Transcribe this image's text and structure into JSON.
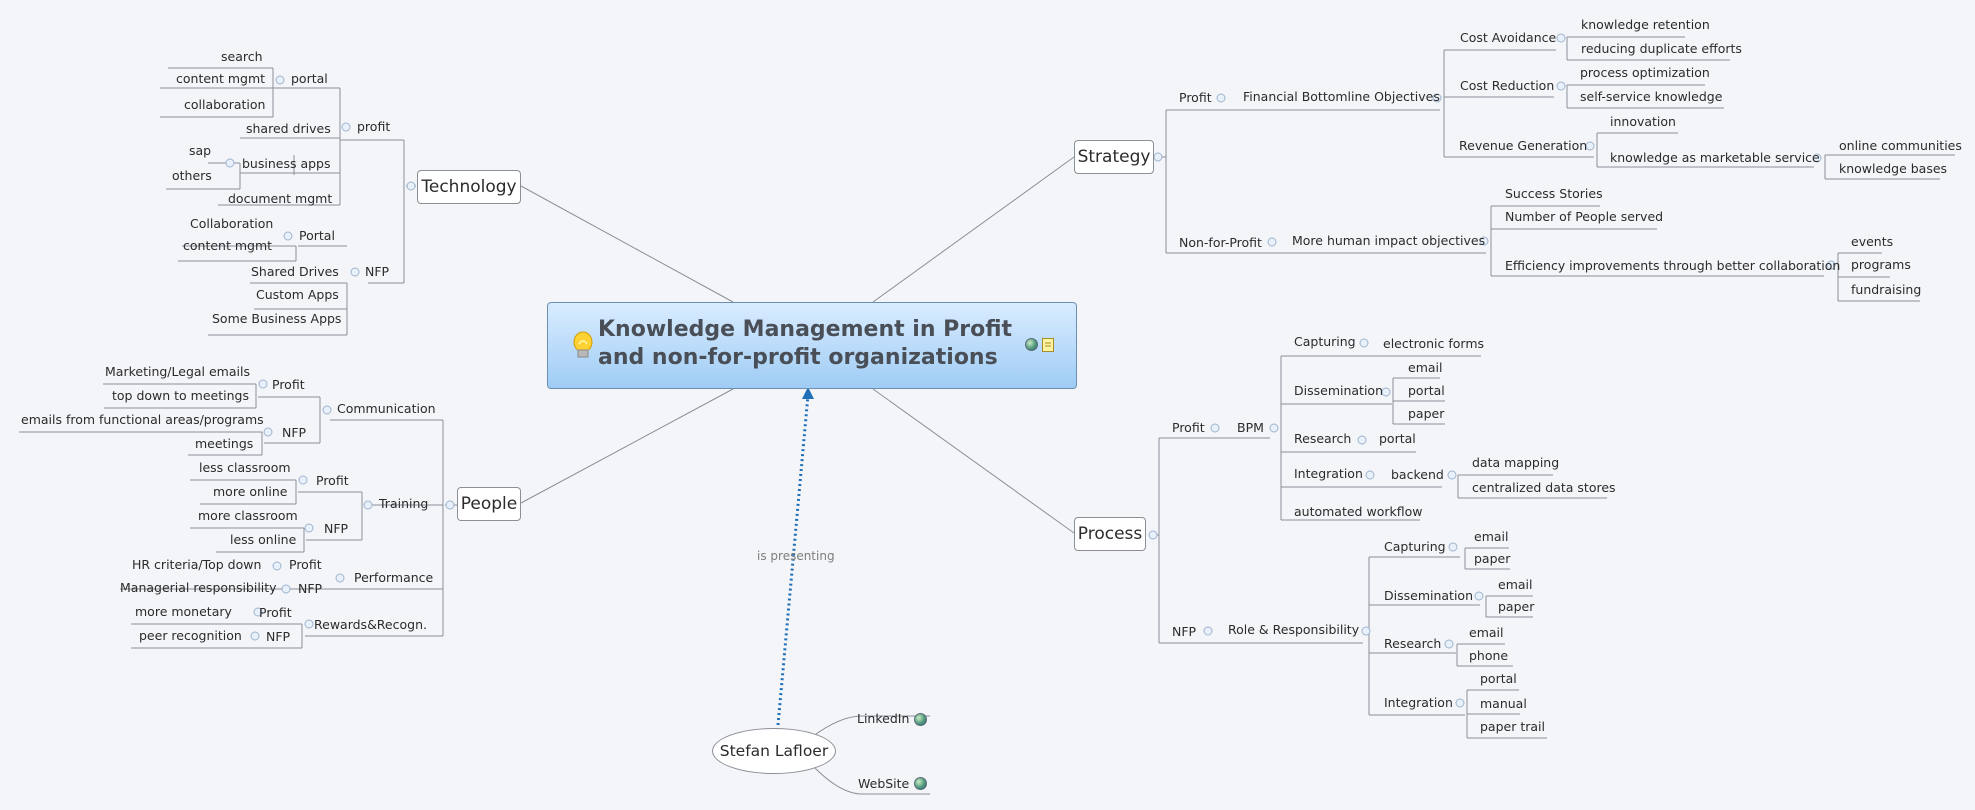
{
  "central": {
    "title_line1": "Knowledge Management in Profit",
    "title_line2": "and non-for-profit organizations",
    "icons": [
      "lightbulb-icon",
      "globe-icon",
      "note-icon"
    ]
  },
  "presenter": {
    "name": "Stefan Lafloer",
    "relationship_label": "is presenting",
    "links": [
      "LinkedIn",
      "WebSite"
    ]
  },
  "technology": {
    "label": "Technology",
    "profit": {
      "label": "profit",
      "portal": {
        "label": "portal",
        "items": [
          "search",
          "content mgmt",
          "collaboration"
        ]
      },
      "shared_drives": "shared drives",
      "business_apps": {
        "label": "business apps",
        "items": [
          "sap",
          "others"
        ]
      },
      "document_mgmt": "document mgmt"
    },
    "nfp": {
      "label": "NFP",
      "portal": {
        "label": "Portal",
        "items": [
          "Collaboration",
          "content mgmt"
        ]
      },
      "items": [
        "Shared Drives",
        "Custom Apps",
        "Some Business Apps"
      ]
    }
  },
  "people": {
    "label": "People",
    "communication": {
      "label": "Communication",
      "profit": {
        "label": "Profit",
        "items": [
          "Marketing/Legal emails",
          "top down to meetings"
        ]
      },
      "nfp": {
        "label": "NFP",
        "items": [
          "emails from functional areas/programs",
          "meetings"
        ]
      }
    },
    "training": {
      "label": "Training",
      "profit": {
        "label": "Profit",
        "items": [
          "less classroom",
          "more online"
        ]
      },
      "nfp": {
        "label": "NFP",
        "items": [
          "more classroom",
          "less online"
        ]
      }
    },
    "performance": {
      "label": "Performance",
      "profit": {
        "label": "Profit",
        "item": "HR criteria/Top down"
      },
      "nfp": {
        "label": "NFP",
        "item": "Managerial responsibility"
      }
    },
    "rewards": {
      "label": "Rewards&Recogn.",
      "profit": {
        "label": "Profit",
        "item": "more monetary"
      },
      "nfp": {
        "label": "NFP",
        "item": "peer recognition"
      }
    }
  },
  "strategy": {
    "label": "Strategy",
    "profit": {
      "label": "Profit",
      "objectives": "Financial Bottomline Objectives",
      "cost_avoidance": {
        "label": "Cost Avoidance",
        "items": [
          "knowledge retention",
          "reducing duplicate efforts"
        ]
      },
      "cost_reduction": {
        "label": "Cost Reduction",
        "items": [
          "process optimization",
          "self-service knowledge"
        ]
      },
      "revenue_generation": {
        "label": "Revenue Generation",
        "innovation": "innovation",
        "marketable": {
          "label": "knowledge as marketable service",
          "items": [
            "online communities",
            "knowledge bases"
          ]
        }
      }
    },
    "nfp": {
      "label": "Non-for-Profit",
      "objectives": "More human impact objectives",
      "items": [
        "Success Stories",
        "Number of People served"
      ],
      "efficiency": {
        "label": "Efficiency improvements through better collaboration",
        "items": [
          "events",
          "programs",
          "fundraising"
        ]
      }
    }
  },
  "process": {
    "label": "Process",
    "profit": {
      "label": "Profit",
      "bpm": {
        "label": "BPM",
        "capturing": {
          "label": "Capturing",
          "items": [
            "electronic forms"
          ]
        },
        "dissemination": {
          "label": "Dissemination",
          "items": [
            "email",
            "portal",
            "paper"
          ]
        },
        "research": {
          "label": "Research",
          "items": [
            "portal"
          ]
        },
        "integration": {
          "label": "Integration",
          "backend": {
            "label": "backend",
            "items": [
              "data mapping",
              "centralized data stores"
            ]
          }
        },
        "automated": "automated workflow"
      }
    },
    "nfp": {
      "label": "NFP",
      "role": {
        "label": "Role & Responsibility",
        "capturing": {
          "label": "Capturing",
          "items": [
            "email",
            "paper"
          ]
        },
        "dissemination": {
          "label": "Dissemination",
          "items": [
            "email",
            "paper"
          ]
        },
        "research": {
          "label": "Research",
          "items": [
            "email",
            "phone"
          ]
        },
        "integration": {
          "label": "Integration",
          "items": [
            "portal",
            "manual",
            "paper trail"
          ]
        }
      }
    }
  },
  "colors": {
    "background": "#f4f5f9",
    "line": "#7d858e",
    "relationship": "#1f6fb8",
    "central_top": "#d9ecff",
    "central_bottom": "#9fccf5"
  }
}
